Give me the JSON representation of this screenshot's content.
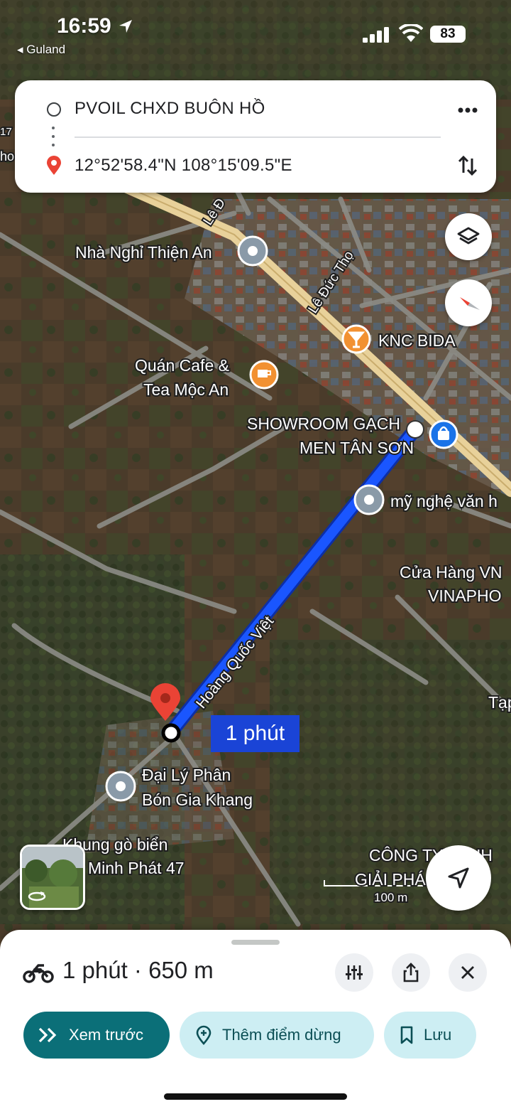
{
  "status_bar": {
    "time": "16:59",
    "back_app": "◂ Guland",
    "battery": "83"
  },
  "route": {
    "origin": "PVOIL CHXD BUÔN HỒ",
    "destination": "12°52'58.4\"N 108°15'09.5\"E",
    "more_icon": "more-horiz-icon",
    "swap_icon": "swap-vert-icon"
  },
  "map": {
    "streets": [
      "Lê Đức Thọ",
      "Lê Đ",
      "Hoàng Quốc Việt"
    ],
    "places": {
      "nha_nghi": "Nhà Nghỉ Thiện An",
      "knc": "KNC BIDA",
      "cafe_1": "Quán Cafe &",
      "cafe_2": "Tea Mộc An",
      "showroom_1": "SHOWROOM GẠCH",
      "showroom_2": "MEN TÂN SƠN",
      "my_nghe": "mỹ nghệ văn h",
      "vnpt_1": "Cửa Hàng VN",
      "vnpt_2": "VINAPHO",
      "tap": "Tạp",
      "dai_ly_1": "Đại Lý Phân",
      "dai_ly_2": "Bón Gia Khang",
      "khung_1": "Khung gò biển",
      "khung_2": "Minh Phát 47",
      "cong_ty_1": "CÔNG TY TNHH",
      "cong_ty_2": "GIẢI PHÁ...",
      "edge_17": "17",
      "edge_ho": "ho"
    },
    "scale": "100 m",
    "eta": "1 phút",
    "colors": {
      "route": "#1a56ff",
      "route_dark": "#0c2fa8",
      "pin": "#ea4335",
      "poi_gray": "#8a9aa8",
      "poi_orange": "#f29132",
      "poi_blue": "#1a73e8",
      "road": "#8c8c86",
      "main_road": "#e8d19a"
    }
  },
  "controls": {
    "layers_icon": "layers-icon",
    "compass_icon": "compass-icon",
    "locate_icon": "navigation-arrow-icon"
  },
  "sheet": {
    "summary": "1 phút · 650 m",
    "mode_icon": "motorcycle-icon",
    "preview_label": "Xem trước",
    "add_stop_label": "Thêm điểm dừng",
    "save_label": "Lưu"
  }
}
